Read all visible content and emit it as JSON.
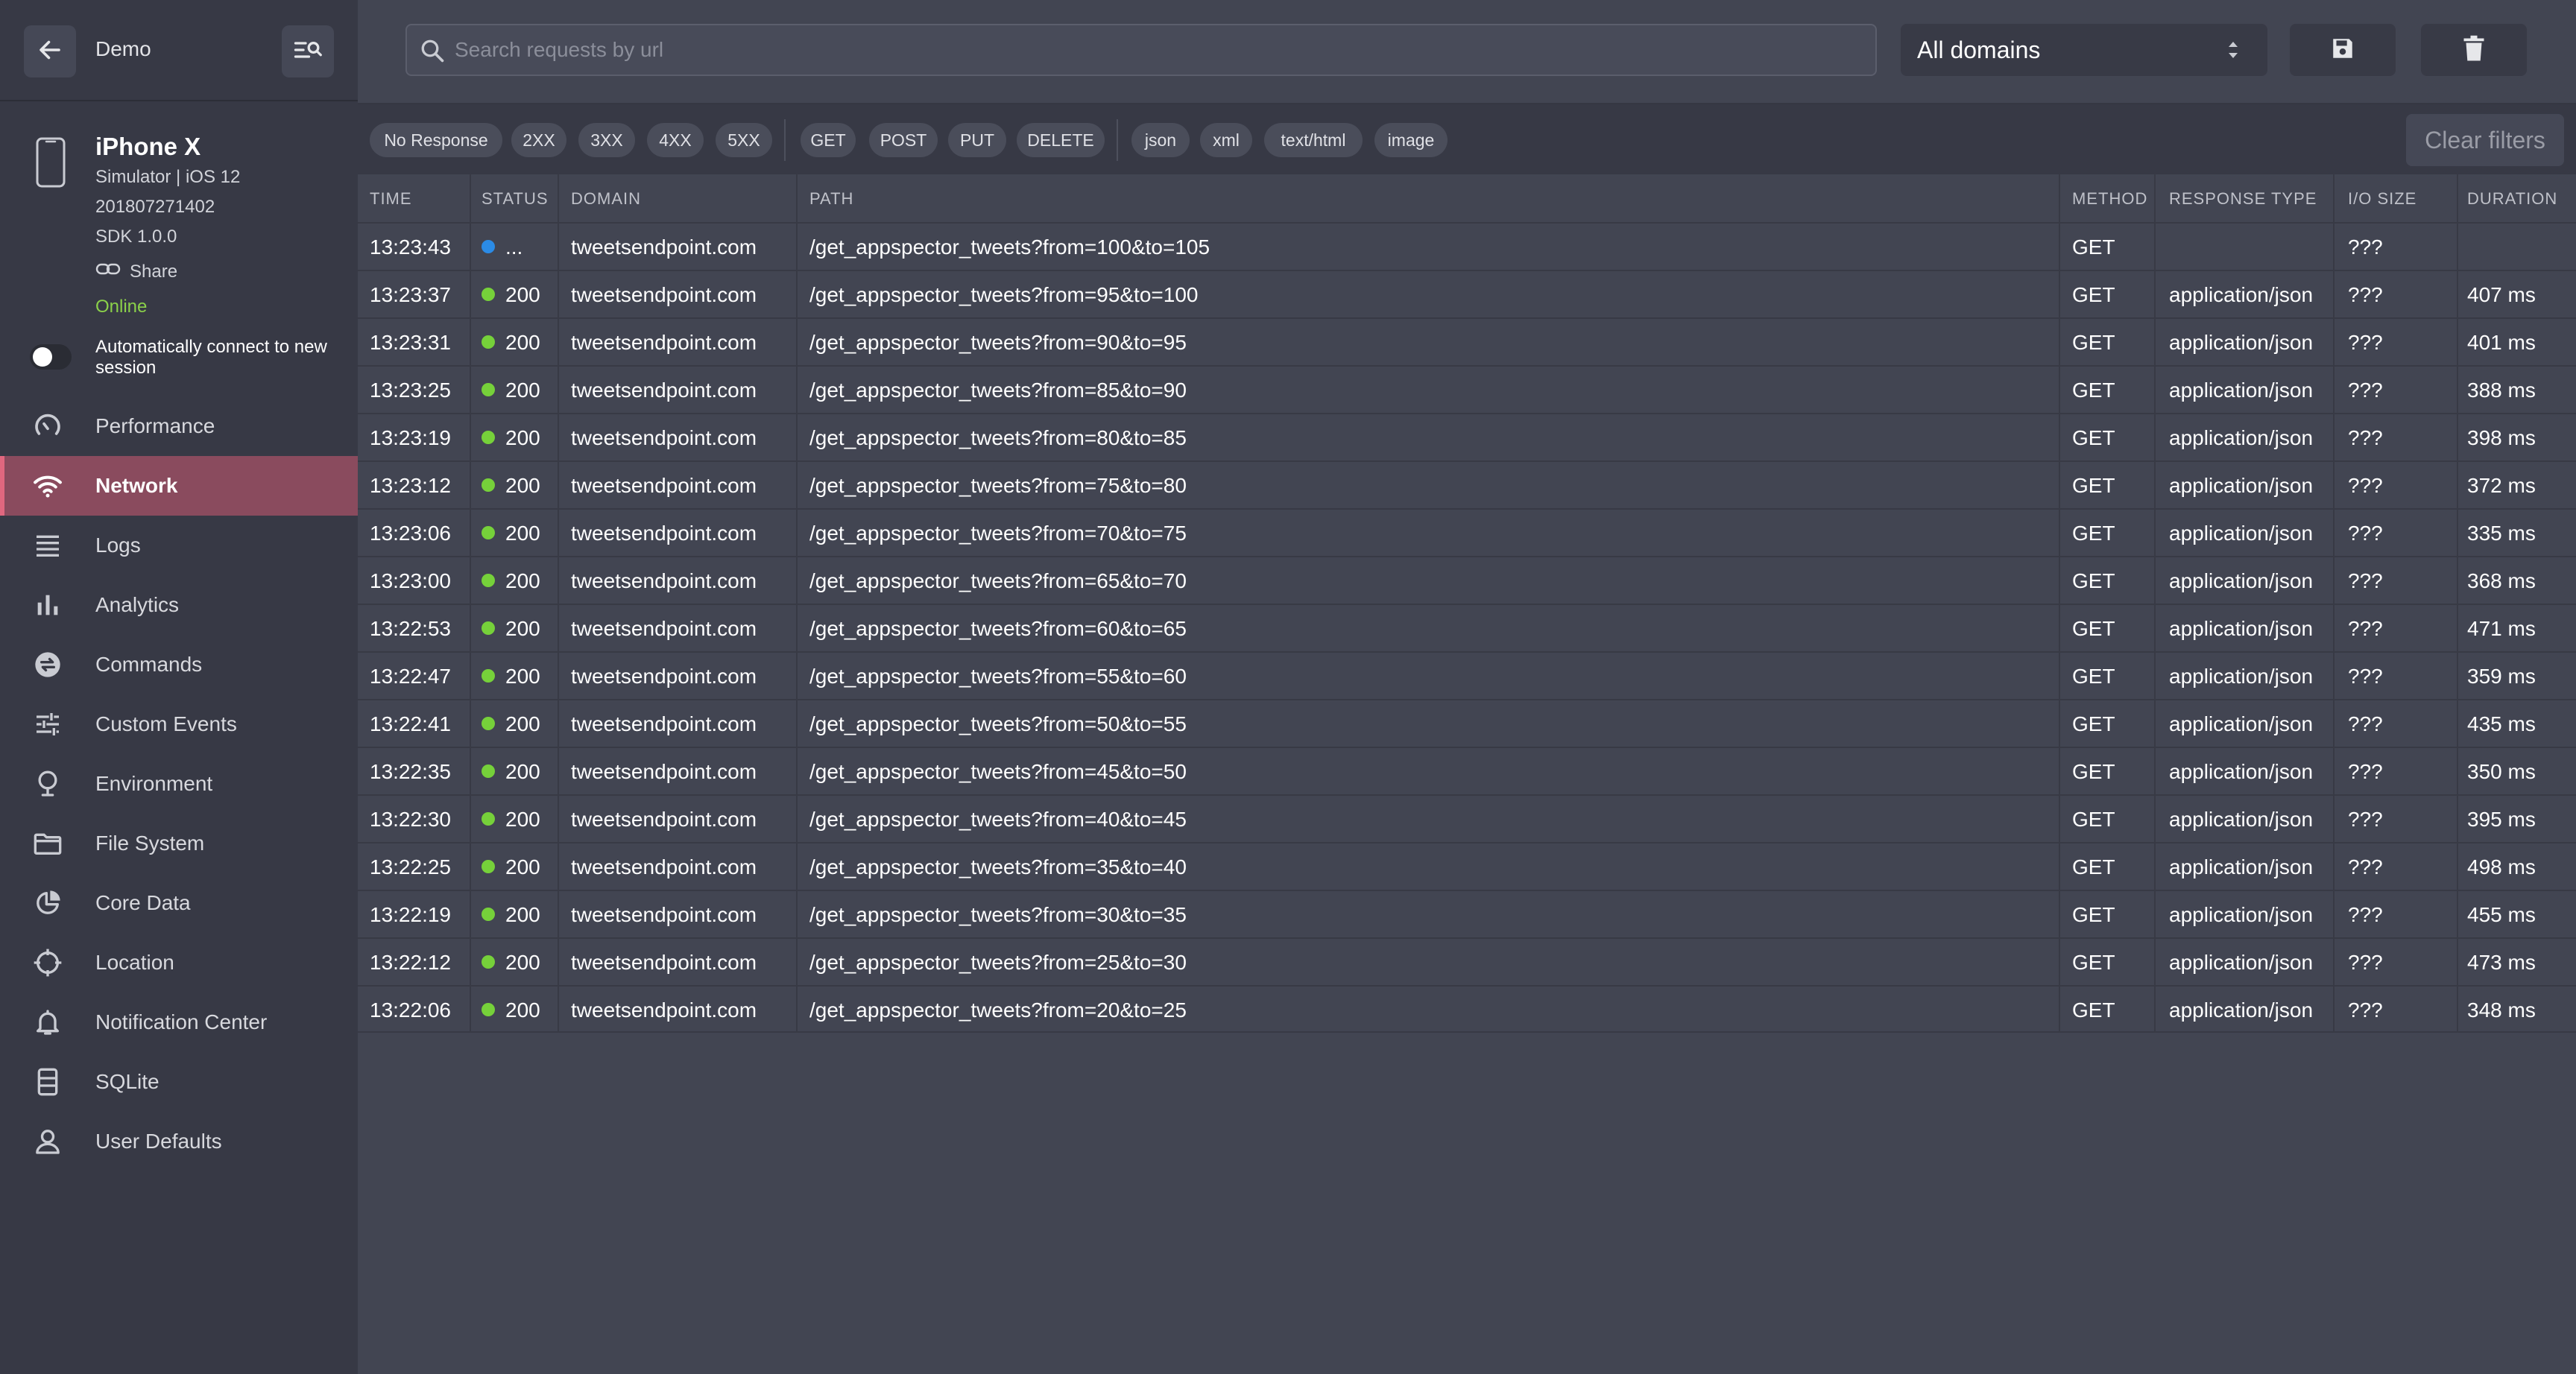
{
  "app": {
    "name": "Demo"
  },
  "device": {
    "name": "iPhone X",
    "platform": "Simulator | iOS 12",
    "build": "201807271402",
    "sdk": "SDK 1.0.0",
    "share_label": "Share",
    "status": "Online"
  },
  "auto_connect": {
    "label": "Automatically connect to new session",
    "enabled": false
  },
  "nav": [
    {
      "label": "Performance",
      "icon": "gauge-icon"
    },
    {
      "label": "Network",
      "icon": "wifi-icon",
      "active": true
    },
    {
      "label": "Logs",
      "icon": "list-lines-icon"
    },
    {
      "label": "Analytics",
      "icon": "bar-chart-icon"
    },
    {
      "label": "Commands",
      "icon": "exchange-icon"
    },
    {
      "label": "Custom Events",
      "icon": "sliders-icon"
    },
    {
      "label": "Environment",
      "icon": "bulb-icon"
    },
    {
      "label": "File System",
      "icon": "folder-icon"
    },
    {
      "label": "Core Data",
      "icon": "pie-chart-icon"
    },
    {
      "label": "Location",
      "icon": "crosshair-icon"
    },
    {
      "label": "Notification Center",
      "icon": "bell-icon"
    },
    {
      "label": "SQLite",
      "icon": "database-icon"
    },
    {
      "label": "User Defaults",
      "icon": "user-icon"
    }
  ],
  "search": {
    "placeholder": "Search requests by url",
    "value": ""
  },
  "domain_filter": {
    "selected": "All domains"
  },
  "filters": {
    "status": [
      "No Response",
      "2XX",
      "3XX",
      "4XX",
      "5XX"
    ],
    "methods": [
      "GET",
      "POST",
      "PUT",
      "DELETE"
    ],
    "types": [
      "json",
      "xml",
      "text/html",
      "image"
    ],
    "clear_label": "Clear filters"
  },
  "table": {
    "columns": [
      "TIME",
      "STATUS",
      "DOMAIN",
      "PATH",
      "METHOD",
      "RESPONSE TYPE",
      "I/O SIZE",
      "DURATION"
    ],
    "rows": [
      {
        "time": "13:23:43",
        "status": "...",
        "pending": true,
        "domain": "tweetsendpoint.com",
        "path": "/get_appspector_tweets?from=100&to=105",
        "method": "GET",
        "type": "",
        "size": "???",
        "duration": ""
      },
      {
        "time": "13:23:37",
        "status": "200",
        "domain": "tweetsendpoint.com",
        "path": "/get_appspector_tweets?from=95&to=100",
        "method": "GET",
        "type": "application/json",
        "size": "???",
        "duration": "407 ms"
      },
      {
        "time": "13:23:31",
        "status": "200",
        "domain": "tweetsendpoint.com",
        "path": "/get_appspector_tweets?from=90&to=95",
        "method": "GET",
        "type": "application/json",
        "size": "???",
        "duration": "401 ms"
      },
      {
        "time": "13:23:25",
        "status": "200",
        "domain": "tweetsendpoint.com",
        "path": "/get_appspector_tweets?from=85&to=90",
        "method": "GET",
        "type": "application/json",
        "size": "???",
        "duration": "388 ms"
      },
      {
        "time": "13:23:19",
        "status": "200",
        "domain": "tweetsendpoint.com",
        "path": "/get_appspector_tweets?from=80&to=85",
        "method": "GET",
        "type": "application/json",
        "size": "???",
        "duration": "398 ms"
      },
      {
        "time": "13:23:12",
        "status": "200",
        "domain": "tweetsendpoint.com",
        "path": "/get_appspector_tweets?from=75&to=80",
        "method": "GET",
        "type": "application/json",
        "size": "???",
        "duration": "372 ms"
      },
      {
        "time": "13:23:06",
        "status": "200",
        "domain": "tweetsendpoint.com",
        "path": "/get_appspector_tweets?from=70&to=75",
        "method": "GET",
        "type": "application/json",
        "size": "???",
        "duration": "335 ms"
      },
      {
        "time": "13:23:00",
        "status": "200",
        "domain": "tweetsendpoint.com",
        "path": "/get_appspector_tweets?from=65&to=70",
        "method": "GET",
        "type": "application/json",
        "size": "???",
        "duration": "368 ms"
      },
      {
        "time": "13:22:53",
        "status": "200",
        "domain": "tweetsendpoint.com",
        "path": "/get_appspector_tweets?from=60&to=65",
        "method": "GET",
        "type": "application/json",
        "size": "???",
        "duration": "471 ms"
      },
      {
        "time": "13:22:47",
        "status": "200",
        "domain": "tweetsendpoint.com",
        "path": "/get_appspector_tweets?from=55&to=60",
        "method": "GET",
        "type": "application/json",
        "size": "???",
        "duration": "359 ms"
      },
      {
        "time": "13:22:41",
        "status": "200",
        "domain": "tweetsendpoint.com",
        "path": "/get_appspector_tweets?from=50&to=55",
        "method": "GET",
        "type": "application/json",
        "size": "???",
        "duration": "435 ms"
      },
      {
        "time": "13:22:35",
        "status": "200",
        "domain": "tweetsendpoint.com",
        "path": "/get_appspector_tweets?from=45&to=50",
        "method": "GET",
        "type": "application/json",
        "size": "???",
        "duration": "350 ms"
      },
      {
        "time": "13:22:30",
        "status": "200",
        "domain": "tweetsendpoint.com",
        "path": "/get_appspector_tweets?from=40&to=45",
        "method": "GET",
        "type": "application/json",
        "size": "???",
        "duration": "395 ms"
      },
      {
        "time": "13:22:25",
        "status": "200",
        "domain": "tweetsendpoint.com",
        "path": "/get_appspector_tweets?from=35&to=40",
        "method": "GET",
        "type": "application/json",
        "size": "???",
        "duration": "498 ms"
      },
      {
        "time": "13:22:19",
        "status": "200",
        "domain": "tweetsendpoint.com",
        "path": "/get_appspector_tweets?from=30&to=35",
        "method": "GET",
        "type": "application/json",
        "size": "???",
        "duration": "455 ms"
      },
      {
        "time": "13:22:12",
        "status": "200",
        "domain": "tweetsendpoint.com",
        "path": "/get_appspector_tweets?from=25&to=30",
        "method": "GET",
        "type": "application/json",
        "size": "???",
        "duration": "473 ms"
      },
      {
        "time": "13:22:06",
        "status": "200",
        "domain": "tweetsendpoint.com",
        "path": "/get_appspector_tweets?from=20&to=25",
        "method": "GET",
        "type": "application/json",
        "size": "???",
        "duration": "348 ms"
      }
    ]
  },
  "colors": {
    "accent": "#e0677f",
    "active_nav_bg": "#8a4b5e",
    "status_ok": "#76d13a",
    "status_pending": "#2b8be6",
    "online": "#8bd14a"
  }
}
